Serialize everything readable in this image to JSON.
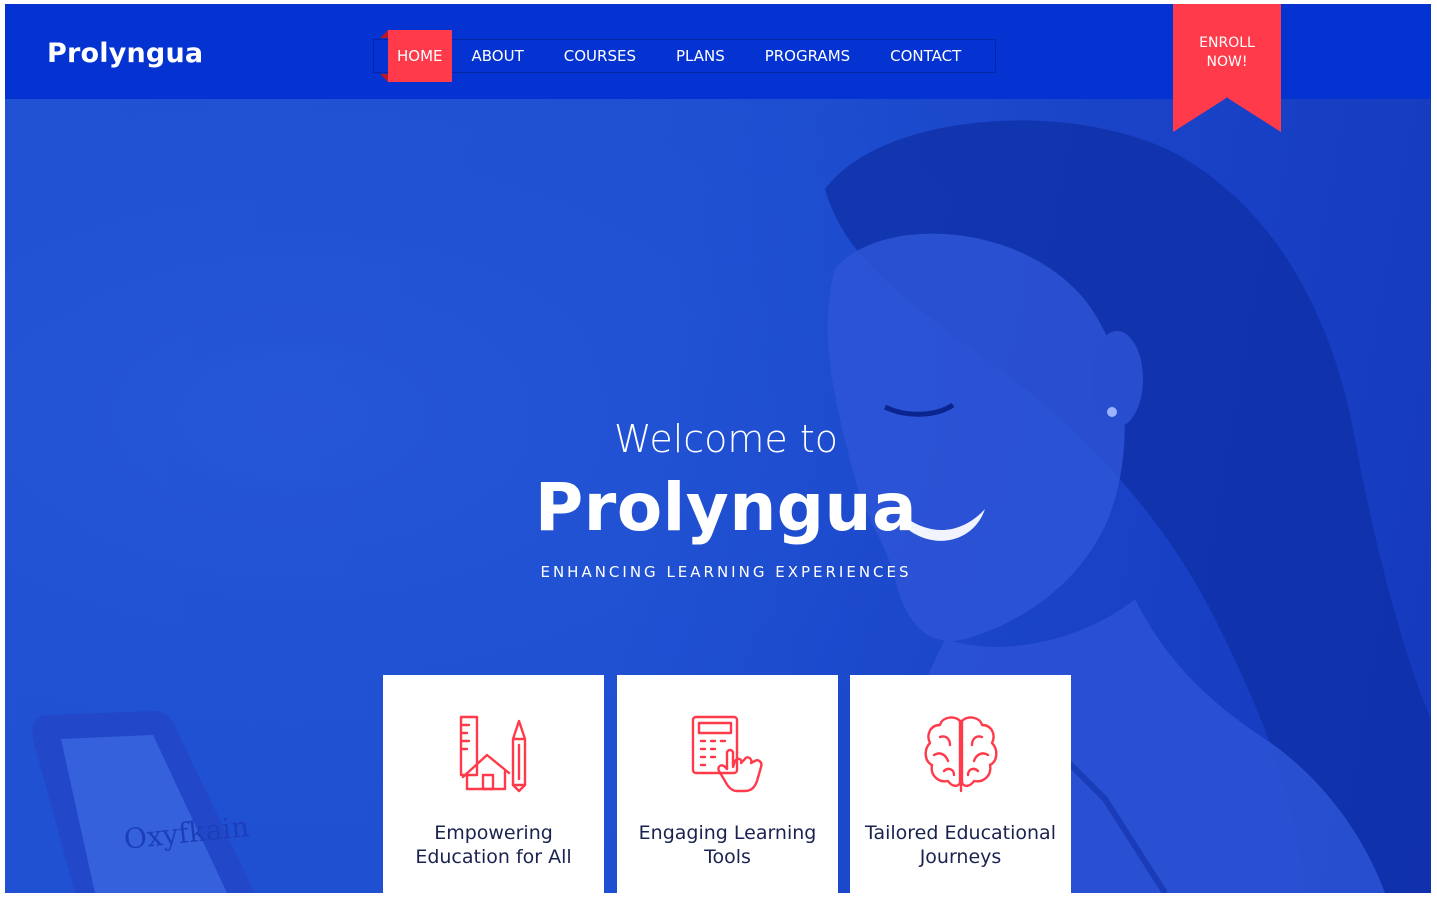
{
  "header": {
    "logo": "Prolyngua",
    "nav": [
      {
        "label": "HOME",
        "active": true
      },
      {
        "label": "ABOUT"
      },
      {
        "label": "COURSES"
      },
      {
        "label": "PLANS"
      },
      {
        "label": "PROGRAMS"
      },
      {
        "label": "CONTACT"
      }
    ],
    "enroll": {
      "line1": "ENROLL",
      "line2": "NOW!"
    }
  },
  "hero": {
    "welcome": "Welcome to",
    "brand": "Prolyngua",
    "tagline": "ENHANCING LEARNING EXPERIENCES"
  },
  "features": [
    {
      "icon": "architecture-tools-icon",
      "line1": "Empowering",
      "line2": "Education for All"
    },
    {
      "icon": "calculator-touch-icon",
      "line1": "Engaging Learning",
      "line2": "Tools"
    },
    {
      "icon": "brain-icon",
      "line1": "Tailored Educational",
      "line2": "Journeys"
    }
  ],
  "colors": {
    "header_bg": "#0533d1",
    "hero_bg": "#1f50d2",
    "accent": "#fe3a4b",
    "card_text": "#1a2350"
  }
}
